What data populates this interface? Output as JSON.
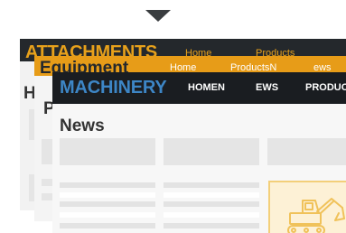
{
  "back_card": {
    "brand": "ATTACHMENTS",
    "nav": [
      "Home",
      "Products"
    ],
    "page_title": "H"
  },
  "middle_card": {
    "brand": "Equipment",
    "nav": [
      "Home",
      "ProductsN",
      "ews"
    ],
    "page_title": "P"
  },
  "front_card": {
    "brand": "MACHINERY",
    "nav": [
      "HOMEN",
      "EWS",
      "PRODUC"
    ],
    "page_title": "News",
    "featured_icon": "excavator-icon"
  },
  "colors": {
    "accent_orange": "#e79c18",
    "header_dark": "#1a1d21",
    "brand_blue": "#3d86c6"
  }
}
